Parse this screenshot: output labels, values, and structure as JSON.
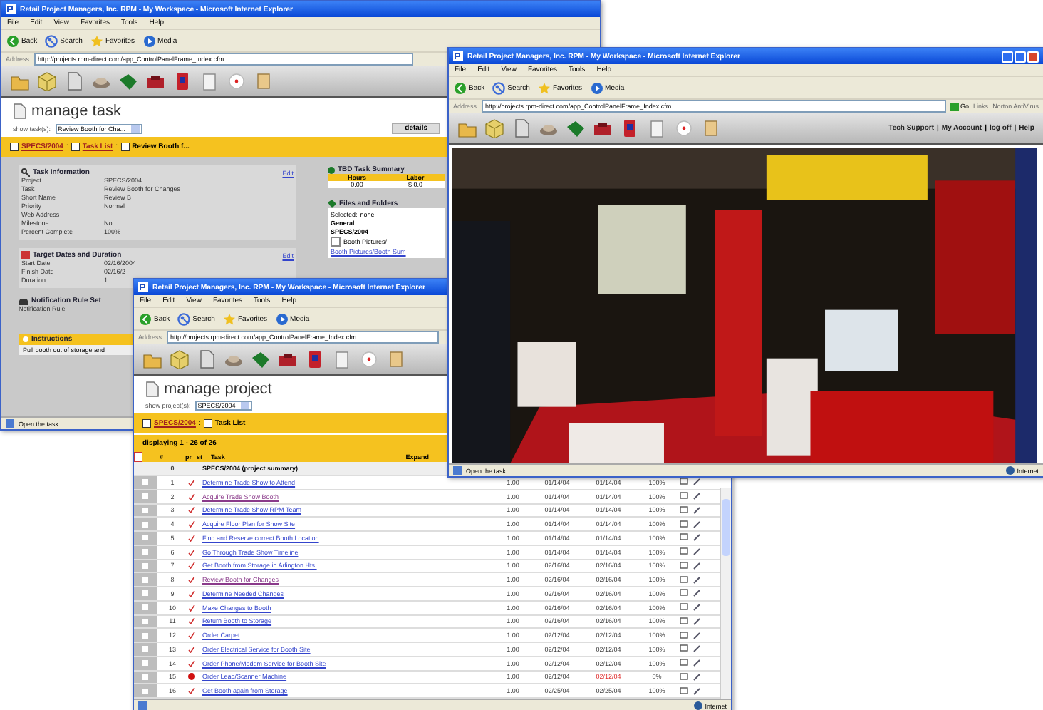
{
  "task_window": {
    "title": "Retail Project Managers, Inc. RPM - My Workspace - Microsoft Internet Explorer",
    "menu": [
      "File",
      "Edit",
      "View",
      "Favorites",
      "Tools",
      "Help"
    ],
    "toolbar": [
      "Back",
      "Search",
      "Favorites",
      "Media"
    ],
    "address_label": "Address",
    "address": "http://projects.rpm-direct.com/app_ControlPanelFrame_Index.cfm",
    "page": {
      "heading": "manage task",
      "filter_label": "show task(s):",
      "filter_value": "Review Booth for Cha...",
      "tab": "details",
      "breadcrumb": [
        "SPECS/2004",
        "Task List",
        "Review Booth f..."
      ],
      "separator": ":",
      "task_info": {
        "title": "Task Information",
        "edit": "Edit",
        "fields": [
          {
            "label": "Project",
            "value": "SPECS/2004"
          },
          {
            "label": "Task",
            "value": "Review Booth for Changes"
          },
          {
            "label": "Short Name",
            "value": "Review B"
          },
          {
            "label": "Priority",
            "value": "Normal"
          },
          {
            "label": "Web Address"
          },
          {
            "label": "Milestone",
            "value": "No"
          },
          {
            "label": "Percent Complete",
            "value": "100%"
          }
        ]
      },
      "dates": {
        "title": "Target Dates and Duration",
        "edit": "Edit",
        "fields": [
          {
            "label": "Start Date",
            "value": "02/16/2004"
          },
          {
            "label": "Finish Date",
            "value": "02/16/2"
          },
          {
            "label": "Duration",
            "value": "1"
          }
        ]
      },
      "notification": {
        "title": "Notification Rule Set",
        "fields": [
          {
            "label": "Notification Rule"
          }
        ]
      },
      "instructions": {
        "title": "Instructions",
        "text": "Pull booth out of storage and"
      },
      "summary": {
        "title": "TBD Task Summary",
        "columns": [
          "Hours",
          "Labor"
        ],
        "values": [
          "0.00",
          "$ 0.0"
        ]
      },
      "files": {
        "title": "Files and Folders",
        "selected_label": "Selected:",
        "selected_value": "none",
        "folder": "General",
        "project": "SPECS/2004",
        "item": "Booth Pictures/",
        "checked": false,
        "link": "Booth Pictures/Booth Sum"
      }
    },
    "status": "Open the task"
  },
  "project_window": {
    "title": "Retail Project Managers, Inc. RPM - My Workspace - Microsoft Internet Explorer",
    "menu": [
      "File",
      "Edit",
      "View",
      "Favorites",
      "Tools",
      "Help"
    ],
    "toolbar": [
      "Back",
      "Search",
      "Favorites",
      "Media"
    ],
    "address_label": "Address",
    "address": "http://projects.rpm-direct.com/app_ControlPanelFrame_Index.cfm",
    "page": {
      "heading": "manage project",
      "filter_label": "show project(s):",
      "filter_value": "SPECS/2004",
      "breadcrumb": [
        "SPECS/2004",
        "Task List"
      ],
      "separator": ":",
      "displaying": "displaying 1 - 26 of 26",
      "columns": [
        "#",
        "pr",
        "st",
        "Task"
      ],
      "expand": "Expand",
      "rows": [
        {
          "kind": "summary",
          "num": "0",
          "task": "SPECS/2004 (project summary)"
        },
        {
          "kind": "task",
          "checked": false,
          "num": "1",
          "late": false,
          "task": "Determine Trade Show to Attend",
          "visited": false,
          "hours": "1.00",
          "start": "01/14/04",
          "finish": "01/14/04",
          "percent": "100%"
        },
        {
          "kind": "task",
          "checked": false,
          "num": "2",
          "late": false,
          "task": "Acquire Trade Show Booth",
          "visited": true,
          "hours": "1.00",
          "start": "01/14/04",
          "finish": "01/14/04",
          "percent": "100%"
        },
        {
          "kind": "task",
          "checked": false,
          "num": "3",
          "late": false,
          "task": "Determine Trade Show RPM Team",
          "visited": false,
          "hours": "1.00",
          "start": "01/14/04",
          "finish": "01/14/04",
          "percent": "100%"
        },
        {
          "kind": "task",
          "checked": false,
          "num": "4",
          "late": false,
          "task": "Acquire Floor Plan for Show Site",
          "visited": false,
          "hours": "1.00",
          "start": "01/14/04",
          "finish": "01/14/04",
          "percent": "100%"
        },
        {
          "kind": "task",
          "checked": false,
          "num": "5",
          "late": false,
          "task": "Find and Reserve correct Booth Location",
          "visited": false,
          "hours": "1.00",
          "start": "01/14/04",
          "finish": "01/14/04",
          "percent": "100%"
        },
        {
          "kind": "task",
          "checked": false,
          "num": "6",
          "late": false,
          "task": "Go Through Trade Show Timeline",
          "visited": false,
          "hours": "1.00",
          "start": "01/14/04",
          "finish": "01/14/04",
          "percent": "100%"
        },
        {
          "kind": "task",
          "checked": false,
          "num": "7",
          "late": false,
          "task": "Get Booth from Storage in Arlington Hts.",
          "visited": false,
          "hours": "1.00",
          "start": "02/16/04",
          "finish": "02/16/04",
          "percent": "100%"
        },
        {
          "kind": "task",
          "checked": false,
          "num": "8",
          "late": false,
          "task": "Review Booth for Changes",
          "visited": true,
          "hours": "1.00",
          "start": "02/16/04",
          "finish": "02/16/04",
          "percent": "100%"
        },
        {
          "kind": "task",
          "checked": false,
          "num": "9",
          "late": false,
          "task": "Determine Needed Changes",
          "visited": false,
          "hours": "1.00",
          "start": "02/16/04",
          "finish": "02/16/04",
          "percent": "100%"
        },
        {
          "kind": "task",
          "checked": false,
          "num": "10",
          "late": false,
          "task": "Make Changes to Booth",
          "visited": false,
          "hours": "1.00",
          "start": "02/16/04",
          "finish": "02/16/04",
          "percent": "100%"
        },
        {
          "kind": "task",
          "checked": false,
          "num": "11",
          "late": false,
          "task": "Return Booth to Storage",
          "visited": false,
          "hours": "1.00",
          "start": "02/16/04",
          "finish": "02/16/04",
          "percent": "100%"
        },
        {
          "kind": "task",
          "checked": false,
          "num": "12",
          "late": false,
          "task": "Order Carpet",
          "visited": false,
          "hours": "1.00",
          "start": "02/12/04",
          "finish": "02/12/04",
          "percent": "100%"
        },
        {
          "kind": "task",
          "checked": false,
          "num": "13",
          "late": false,
          "task": "Order Electrical Service for Booth Site",
          "visited": false,
          "hours": "1.00",
          "start": "02/12/04",
          "finish": "02/12/04",
          "percent": "100%"
        },
        {
          "kind": "task",
          "checked": false,
          "num": "14",
          "late": false,
          "task": "Order Phone/Modem Service for Booth Site",
          "visited": false,
          "hours": "1.00",
          "start": "02/12/04",
          "finish": "02/12/04",
          "percent": "100%"
        },
        {
          "kind": "task",
          "checked": false,
          "num": "15",
          "late": true,
          "task": "Order Lead/Scanner Machine",
          "visited": false,
          "hours": "1.00",
          "start": "02/12/04",
          "finish": "02/12/04",
          "percent": "0%"
        },
        {
          "kind": "task",
          "checked": false,
          "num": "16",
          "late": false,
          "task": "Get Booth again from Storage",
          "visited": false,
          "hours": "1.00",
          "start": "02/25/04",
          "finish": "02/25/04",
          "percent": "100%"
        }
      ]
    },
    "zone": "Internet"
  },
  "photo_window": {
    "title": "Retail Project Managers, Inc. RPM - My Workspace - Microsoft Internet Explorer",
    "menu": [
      "File",
      "Edit",
      "View",
      "Favorites",
      "Tools",
      "Help"
    ],
    "toolbar": [
      "Back",
      "Search",
      "Favorites",
      "Media"
    ],
    "address_label": "Address",
    "address": "http://projects.rpm-direct.com/app_ControlPanelFrame_Index.cfm",
    "go": "Go",
    "links": "Links",
    "antivirus": "Norton AntiVirus",
    "top_links": [
      "Tech Support",
      "My Account",
      "log off",
      "Help"
    ],
    "link_separator": "|",
    "status": "Open the task",
    "zone": "Internet"
  }
}
